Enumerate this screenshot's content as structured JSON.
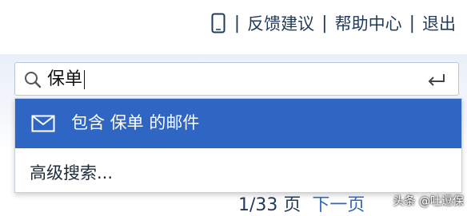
{
  "top_nav": {
    "feedback": "反馈建议",
    "help": "帮助中心",
    "logout": "退出",
    "separator": "|",
    "phone_icon": "mobile-phone-icon"
  },
  "search": {
    "value": "保单",
    "search_icon": "search-icon",
    "enter_icon": "enter-icon"
  },
  "dropdown": {
    "suggestion_label": "包含 保单 的邮件",
    "suggestion_icon": "mail-icon",
    "advanced_label": "高级搜索..."
  },
  "pagination": {
    "page_info": "1/33 页",
    "next_label": "下一页"
  },
  "watermark": "头条 @吐逗保",
  "colors": {
    "accent": "#2f66c3",
    "text": "#1f3a5a"
  }
}
